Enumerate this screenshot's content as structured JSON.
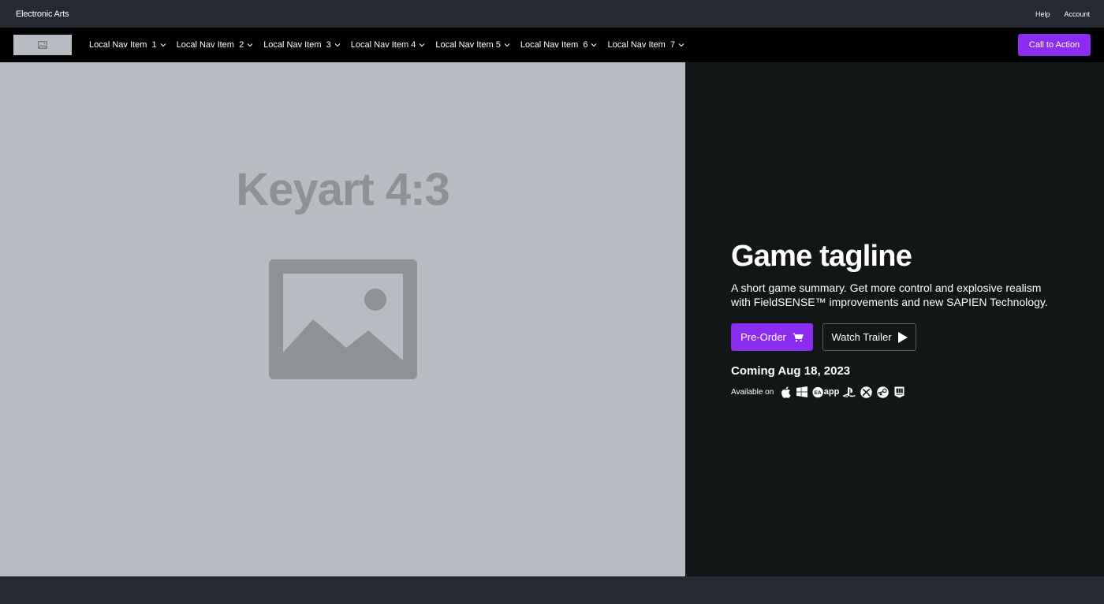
{
  "global_bar": {
    "brand": "Electronic Arts",
    "links": [
      "Help",
      "Account"
    ]
  },
  "local_nav": {
    "logo_icon": "image-icon",
    "items": [
      {
        "label": "Local Nav Item  1"
      },
      {
        "label": "Local Nav Item  2"
      },
      {
        "label": "Local Nav Item  3"
      },
      {
        "label": "Local Nav Item 4"
      },
      {
        "label": "Local Nav Item 5"
      },
      {
        "label": "Local Nav Item  6"
      },
      {
        "label": "Local Nav Item  7"
      }
    ],
    "cta_label": "Call to Action"
  },
  "hero": {
    "keyart_label": "Keyart 4:3",
    "tagline": "Game tagline",
    "summary": "A short game summary. Get more control and explosive realism with FieldSENSE™ improvements and new SAPIEN Technology.",
    "primary_button": "Pre-Order",
    "secondary_button": "Watch Trailer",
    "release": "Coming Aug 18, 2023",
    "available_label": "Available on",
    "platforms": [
      "apple-icon",
      "windows-icon",
      "ea-app-icon",
      "playstation-icon",
      "xbox-icon",
      "steam-icon",
      "epic-games-icon"
    ],
    "ea_app_text": "app"
  },
  "colors": {
    "accent": "#8b2df0",
    "page_bg": "#262a33",
    "nav_bg": "#000000",
    "hero_panel_bg": "#131617",
    "keyart_bg": "#b8bcc3"
  }
}
